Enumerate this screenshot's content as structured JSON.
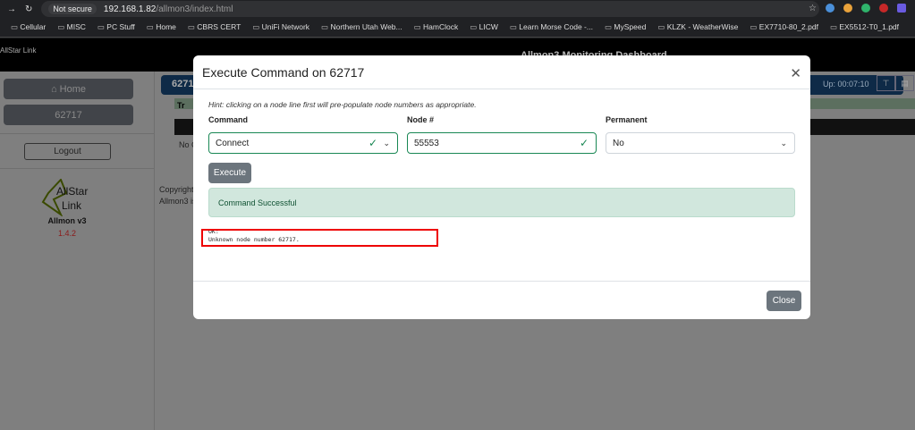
{
  "browser": {
    "security": "Not secure",
    "host": "192.168.1.82",
    "path": "/allmon3/index.html",
    "bookmarks": [
      "Cellular",
      "MISC",
      "PC Stuff",
      "Home",
      "CBRS CERT",
      "UniFi Network",
      "Northern Utah Web...",
      "HamClock",
      "LICW",
      "Learn Morse Code -...",
      "MySpeed",
      "KLZK - WeatherWise",
      "EX7710-80_2.pdf",
      "EX5512-T0_1.pdf"
    ]
  },
  "app": {
    "title": "Allmon3 Monitoring Dashboard",
    "logo_text": "AllStar Link",
    "sidebar": {
      "home": "Home",
      "node": "62717",
      "logout": "Logout",
      "app_name": "Allmon v3",
      "version": "1.4.2"
    },
    "main": {
      "node_frag": "6271",
      "uptime": "Up: 00:07:10",
      "green_frag": "Tr",
      "row_frag": "No C",
      "copyright_frag": "Copyright",
      "allmon_frag": "Allmon3 is"
    }
  },
  "modal": {
    "title": "Execute Command on 62717",
    "hint": "Hint: clicking on a node line first will pre-populate node numbers as appropriate.",
    "command_label": "Command",
    "command_value": "Connect",
    "node_label": "Node #",
    "node_value": "55553",
    "permanent_label": "Permanent",
    "permanent_value": "No",
    "execute": "Execute",
    "alert": "Command Successful",
    "output": [
      "OK:",
      "Unknown node number 62717."
    ],
    "close": "Close"
  }
}
